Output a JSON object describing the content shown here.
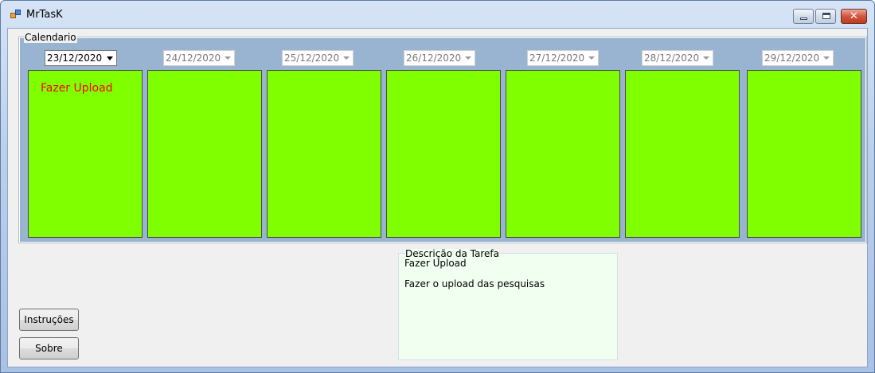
{
  "window": {
    "title": "MrTasK"
  },
  "calendar": {
    "label": "Calendario",
    "dates": [
      {
        "value": "23/12/2020",
        "active": true,
        "task": "Fazer Upload"
      },
      {
        "value": "24/12/2020",
        "active": false,
        "task": ""
      },
      {
        "value": "25/12/2020",
        "active": false,
        "task": ""
      },
      {
        "value": "26/12/2020",
        "active": false,
        "task": ""
      },
      {
        "value": "27/12/2020",
        "active": false,
        "task": ""
      },
      {
        "value": "28/12/2020",
        "active": false,
        "task": ""
      },
      {
        "value": "29/12/2020",
        "active": false,
        "task": ""
      }
    ],
    "panel_color": "#7fff00",
    "task_color": "#ff0000"
  },
  "buttons": {
    "instructions": "Instruções",
    "about": "Sobre"
  },
  "description": {
    "label": "Descrição da Tarefa",
    "title": "Fazer Upload",
    "body": "Fazer o upload das pesquisas"
  }
}
